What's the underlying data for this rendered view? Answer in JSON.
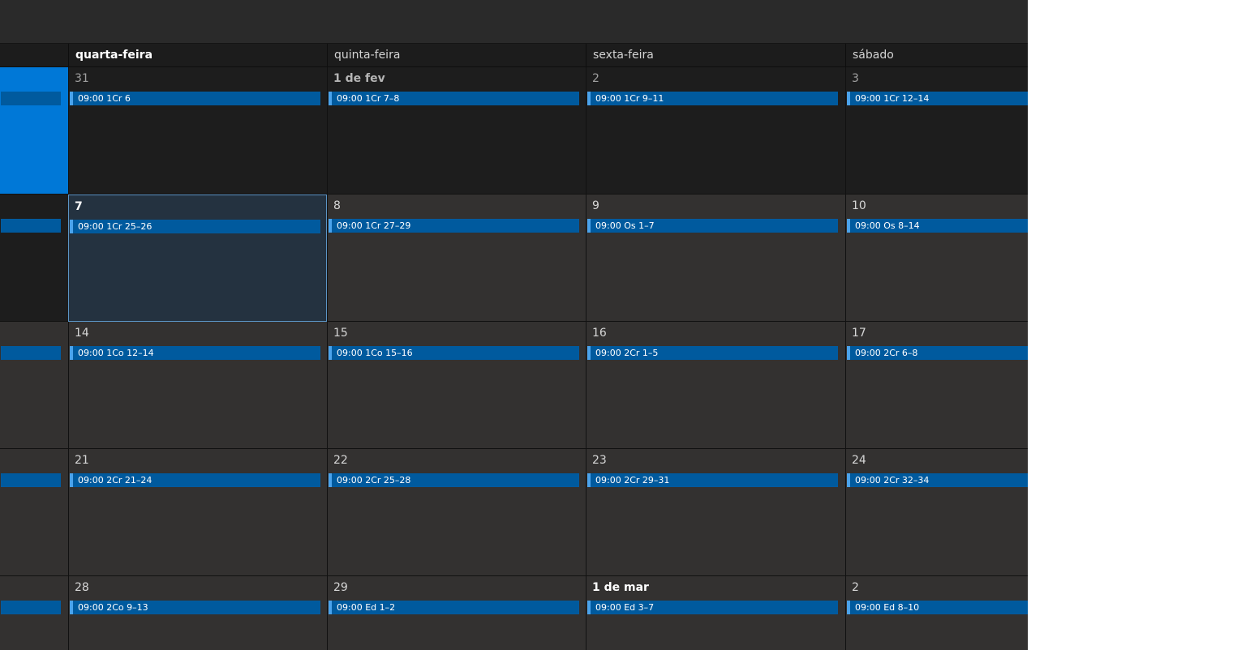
{
  "day_headers": [
    "quarta-feira",
    "quinta-feira",
    "sexta-feira",
    "sábado"
  ],
  "weeks": [
    {
      "days": [
        {
          "date": "31",
          "event": "09:00 1Cr 6"
        },
        {
          "date": "1 de fev",
          "event": "09:00 1Cr 7–8"
        },
        {
          "date": "2",
          "event": "09:00 1Cr 9–11"
        },
        {
          "date": "3",
          "event": "09:00 1Cr 12–14"
        }
      ]
    },
    {
      "days": [
        {
          "date": "7",
          "event": "09:00 1Cr 25–26"
        },
        {
          "date": "8",
          "event": "09:00 1Cr 27–29"
        },
        {
          "date": "9",
          "event": "09:00 Os 1–7"
        },
        {
          "date": "10",
          "event": "09:00 Os 8–14"
        }
      ]
    },
    {
      "days": [
        {
          "date": "14",
          "event": "09:00 1Co 12–14"
        },
        {
          "date": "15",
          "event": "09:00 1Co 15–16"
        },
        {
          "date": "16",
          "event": "09:00 2Cr 1–5"
        },
        {
          "date": "17",
          "event": "09:00 2Cr 6–8"
        }
      ]
    },
    {
      "days": [
        {
          "date": "21",
          "event": "09:00 2Cr 21–24"
        },
        {
          "date": "22",
          "event": "09:00 2Cr 25–28"
        },
        {
          "date": "23",
          "event": "09:00 2Cr 29–31"
        },
        {
          "date": "24",
          "event": "09:00 2Cr 32–34"
        }
      ]
    },
    {
      "days": [
        {
          "date": "28",
          "event": "09:00 2Co 9–13"
        },
        {
          "date": "29",
          "event": "09:00 Ed 1–2"
        },
        {
          "date": "1 de mar",
          "event": "09:00 Ed 3–7"
        },
        {
          "date": "2",
          "event": "09:00 Ed 8–10"
        }
      ]
    }
  ],
  "colors": {
    "background": "#2d2c2c",
    "other_month": "#1d1d1d",
    "today": "#0078d7",
    "event": "#005a9e",
    "selected": "#243240"
  }
}
